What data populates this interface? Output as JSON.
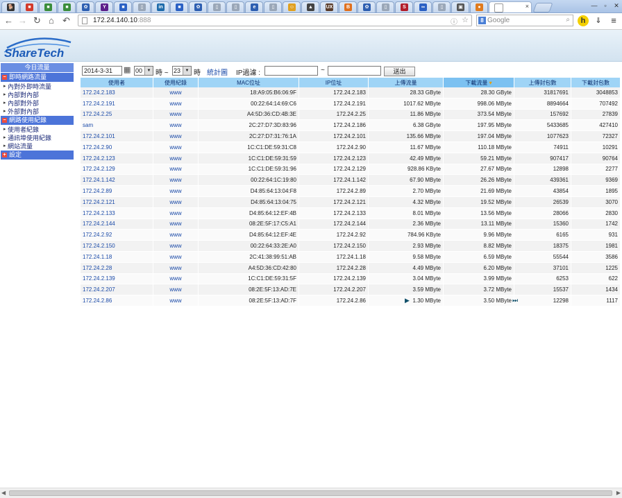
{
  "browser": {
    "tabs": [
      {
        "icon": "dog-icon",
        "color": "#333333",
        "glyph": "🐕"
      },
      {
        "icon": "red-tab-icon",
        "color": "#d23a2b",
        "glyph": "■"
      },
      {
        "icon": "green-tab-icon",
        "color": "#3b8d3b",
        "glyph": "■"
      },
      {
        "icon": "green-tab-icon",
        "color": "#3b8d3b",
        "glyph": "■"
      },
      {
        "icon": "paw-icon",
        "color": "#2e5fb1",
        "glyph": "✿"
      },
      {
        "icon": "yahoo-icon",
        "color": "#5c1f8a",
        "glyph": "Y"
      },
      {
        "icon": "blue-square-icon",
        "color": "#2b61c4",
        "glyph": "■"
      },
      {
        "icon": "page-icon",
        "color": "#9aa7b8",
        "glyph": "▯"
      },
      {
        "icon": "linkedin-icon",
        "color": "#1f6cab",
        "glyph": "in"
      },
      {
        "icon": "blue-square-icon",
        "color": "#2b61c4",
        "glyph": "■"
      },
      {
        "icon": "paw-icon",
        "color": "#2e5fb1",
        "glyph": "✿"
      },
      {
        "icon": "page-icon",
        "color": "#9aa7b8",
        "glyph": "▯"
      },
      {
        "icon": "page-icon",
        "color": "#9aa7b8",
        "glyph": "▯"
      },
      {
        "icon": "e-icon",
        "color": "#2e5fb1",
        "glyph": "e"
      },
      {
        "icon": "page-icon",
        "color": "#9aa7b8",
        "glyph": "▯"
      },
      {
        "icon": "emoji-icon",
        "color": "#e0a020",
        "glyph": "☺"
      },
      {
        "icon": "linux-icon",
        "color": "#444444",
        "glyph": "▲"
      },
      {
        "icon": "ux-icon",
        "color": "#5a3d2b",
        "glyph": "UX"
      },
      {
        "icon": "blogger-icon",
        "color": "#e0701e",
        "glyph": "B"
      },
      {
        "icon": "paw-icon",
        "color": "#2e5fb1",
        "glyph": "✿"
      },
      {
        "icon": "page-icon",
        "color": "#9aa7b8",
        "glyph": "▯"
      },
      {
        "icon": "s-icon",
        "color": "#b21e2b",
        "glyph": "S"
      },
      {
        "icon": "chain-icon",
        "color": "#2b61c4",
        "glyph": "∞"
      },
      {
        "icon": "page-icon",
        "color": "#9aa7b8",
        "glyph": "▯"
      },
      {
        "icon": "image-icon",
        "color": "#555555",
        "glyph": "▣"
      },
      {
        "icon": "orange-circle-icon",
        "color": "#e07b1e",
        "glyph": "●"
      }
    ],
    "active_tab_icon": "page-icon",
    "url_host": "172.24.140.10",
    "url_port": ":888",
    "search_placeholder": "Google",
    "window_controls": [
      "—",
      "▫",
      "✕"
    ]
  },
  "sidebar": {
    "today_traffic": "今日流量",
    "sections": [
      {
        "label": "即時網路流量",
        "toggle": "−",
        "items": [
          "內對外即時流量",
          "內部對內部",
          "內部對外部",
          "外部對內部"
        ]
      },
      {
        "label": "網路使用紀錄",
        "toggle": "−",
        "items": [
          "使用者紀錄",
          "通訊埠使用紀錄",
          "網站流量"
        ]
      },
      {
        "label": "設定",
        "toggle": "+",
        "items": []
      }
    ]
  },
  "filter": {
    "date": "2014-3-31",
    "hour_from": "00",
    "hour_sep": "時 ~",
    "hour_to": "23",
    "hour_unit": "時",
    "chart_link": "統計圖",
    "ip_filter_label": "IP過濾 :",
    "range_sep": "~",
    "submit": "送出"
  },
  "table": {
    "headers": [
      "使用者",
      "使用紀錄",
      "MAC位址",
      "IP位址",
      "上傳流量",
      "下載流量",
      "上傳封包數",
      "下載封包數"
    ],
    "rows": [
      [
        "172.24.2.183",
        "www",
        "18:A9:05:B6:06:9F",
        "172.24.2.183",
        "28.33 GByte",
        "28.30 GByte",
        "31817691",
        "3048853"
      ],
      [
        "172.24.2.191",
        "www",
        "00:22:64:14:69:C6",
        "172.24.2.191",
        "1017.62 MByte",
        "998.06 MByte",
        "8894664",
        "707492"
      ],
      [
        "172.24.2.25",
        "www",
        "A4:5D:36:CD:4B:3E",
        "172.24.2.25",
        "11.86 MByte",
        "373.54 MByte",
        "157692",
        "27839"
      ],
      [
        "sam",
        "www",
        "2C:27:D7:3D:83:96",
        "172.24.2.186",
        "6.38 GByte",
        "197.95 MByte",
        "5433685",
        "427410"
      ],
      [
        "172.24.2.101",
        "www",
        "2C:27:D7:31:76:1A",
        "172.24.2.101",
        "135.66 MByte",
        "197.04 MByte",
        "1077623",
        "72327"
      ],
      [
        "172.24.2.90",
        "www",
        "1C:C1:DE:59:31:C8",
        "172.24.2.90",
        "11.67 MByte",
        "110.18 MByte",
        "74911",
        "10291"
      ],
      [
        "172.24.2.123",
        "www",
        "1C:C1:DE:59:31:59",
        "172.24.2.123",
        "42.49 MByte",
        "59.21 MByte",
        "907417",
        "90764"
      ],
      [
        "172.24.2.129",
        "www",
        "1C:C1:DE:59:31:96",
        "172.24.2.129",
        "928.86 KByte",
        "27.67 MByte",
        "12898",
        "2277"
      ],
      [
        "172.24.1.142",
        "www",
        "00:22:64:1C:19:80",
        "172.24.1.142",
        "67.90 MByte",
        "26.26 MByte",
        "439361",
        "9369"
      ],
      [
        "172.24.2.89",
        "www",
        "D4:85:64:13:04:F8",
        "172.24.2.89",
        "2.70 MByte",
        "21.69 MByte",
        "43854",
        "1895"
      ],
      [
        "172.24.2.121",
        "www",
        "D4:85:64:13:04:75",
        "172.24.2.121",
        "4.32 MByte",
        "19.52 MByte",
        "26539",
        "3070"
      ],
      [
        "172.24.2.133",
        "www",
        "D4:85:64:12:EF:4B",
        "172.24.2.133",
        "8.01 MByte",
        "13.56 MByte",
        "28066",
        "2830"
      ],
      [
        "172.24.2.144",
        "www",
        "08:2E:5F:17:C5:A1",
        "172.24.2.144",
        "2.36 MByte",
        "13.11 MByte",
        "15360",
        "1742"
      ],
      [
        "172.24.2.92",
        "www",
        "D4:85:64:12:EF:4E",
        "172.24.2.92",
        "784.96 KByte",
        "9.96 MByte",
        "6165",
        "931"
      ],
      [
        "172.24.2.150",
        "www",
        "00:22:64:33:2E:A0",
        "172.24.2.150",
        "2.93 MByte",
        "8.82 MByte",
        "18375",
        "1981"
      ],
      [
        "172.24.1.18",
        "www",
        "2C:41:38:99:51:AB",
        "172.24.1.18",
        "9.58 MByte",
        "6.59 MByte",
        "55544",
        "3586"
      ],
      [
        "172.24.2.28",
        "www",
        "A4:5D:36:CD:42:80",
        "172.24.2.28",
        "4.49 MByte",
        "6.20 MByte",
        "37101",
        "1225"
      ],
      [
        "172.24.2.139",
        "www",
        "1C:C1:DE:59:31:5F",
        "172.24.2.139",
        "3.04 MByte",
        "3.99 MByte",
        "6253",
        "622"
      ],
      [
        "172.24.2.207",
        "www",
        "08:2E:5F:13:AD:7E",
        "172.24.2.207",
        "3.59 MByte",
        "3.72 MByte",
        "15537",
        "1434"
      ],
      [
        "172.24.2.86",
        "www",
        "08:2E:5F:13:AD:7F",
        "172.24.2.86",
        "1.30 MByte",
        "3.50 MByte",
        "12298",
        "1117"
      ]
    ],
    "sorted_column_index": 5
  },
  "pager": {
    "next": "▶",
    "last": "⏭"
  },
  "colors": {
    "sidebar_primary": "#4c74d9",
    "header_cell": "#9fd4f6",
    "link": "#1a4aa8"
  }
}
